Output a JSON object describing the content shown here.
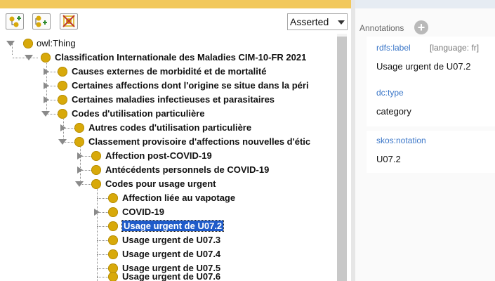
{
  "toolbar": {
    "view_mode": "Asserted"
  },
  "tree": {
    "rows": [
      {
        "label": "owl:Thing",
        "bold": false,
        "expanded": true,
        "selected": false
      },
      {
        "label": "Classification Internationale des Maladies CIM-10-FR 2021",
        "bold": true,
        "expanded": true,
        "selected": false
      },
      {
        "label": "Causes externes de morbidité et de mortalité",
        "bold": true,
        "expanded": false,
        "selected": false
      },
      {
        "label": "Certaines affections dont l'origine se situe dans la péri",
        "bold": true,
        "expanded": false,
        "selected": false
      },
      {
        "label": "Certaines maladies infectieuses et parasitaires",
        "bold": true,
        "expanded": false,
        "selected": false
      },
      {
        "label": "Codes d'utilisation particulière",
        "bold": true,
        "expanded": true,
        "selected": false
      },
      {
        "label": "Autres codes d'utilisation particulière",
        "bold": true,
        "expanded": false,
        "selected": false
      },
      {
        "label": "Classement provisoire d'affections nouvelles d'étic",
        "bold": true,
        "expanded": true,
        "selected": false
      },
      {
        "label": "Affection post-COVID-19",
        "bold": true,
        "expanded": false,
        "selected": false
      },
      {
        "label": "Antécédents personnels de COVID-19",
        "bold": true,
        "expanded": false,
        "selected": false
      },
      {
        "label": "Codes pour usage urgent",
        "bold": true,
        "expanded": true,
        "selected": false
      },
      {
        "label": "Affection liée au vapotage",
        "bold": true,
        "expanded": null,
        "selected": false
      },
      {
        "label": "COVID-19",
        "bold": true,
        "expanded": false,
        "selected": false
      },
      {
        "label": "Usage urgent de U07.2",
        "bold": true,
        "expanded": null,
        "selected": true
      },
      {
        "label": "Usage urgent de U07.3",
        "bold": true,
        "expanded": null,
        "selected": false
      },
      {
        "label": "Usage urgent de U07.4",
        "bold": true,
        "expanded": null,
        "selected": false
      },
      {
        "label": "Usage urgent de U07.5",
        "bold": true,
        "expanded": null,
        "selected": false
      },
      {
        "label": "Usage urgent de U07.6",
        "bold": true,
        "expanded": null,
        "selected": false
      }
    ]
  },
  "annotations": {
    "header": "Annotations",
    "items": [
      {
        "property": "rdfs:label",
        "language": "[language: fr]",
        "value": "Usage urgent de U07.2"
      },
      {
        "property": "dc:type",
        "language": "",
        "value": "category"
      },
      {
        "property": "skos:notation",
        "language": "",
        "value": "U07.2"
      }
    ]
  },
  "colors": {
    "accent_band": "#f2c85b",
    "node": "#d8a90a",
    "selection": "#1f5bc9",
    "property_link": "#3a76c8"
  }
}
